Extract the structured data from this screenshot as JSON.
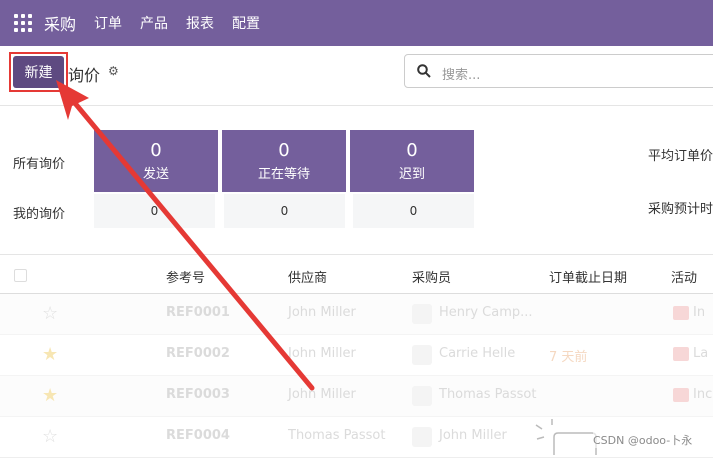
{
  "topbar": {
    "app_name": "采购",
    "menu": [
      "订单",
      "产品",
      "报表",
      "配置"
    ]
  },
  "control": {
    "new_button": "新建",
    "title": "询价",
    "search_placeholder": "搜索..."
  },
  "dashboard": {
    "row_labels": [
      "所有询价",
      "我的询价"
    ],
    "tiles": [
      {
        "count": "0",
        "label": "发送"
      },
      {
        "count": "0",
        "label": "正在等待"
      },
      {
        "count": "0",
        "label": "迟到"
      }
    ],
    "my_counts": [
      "0",
      "0",
      "0"
    ],
    "right_labels": [
      "平均订单价",
      "采购预计时"
    ]
  },
  "table": {
    "headers": [
      "参考号",
      "供应商",
      "采购员",
      "订单截止日期",
      "活动"
    ],
    "rows": [
      {
        "ref": "REF0001",
        "vendor": "John Miller",
        "buyer": "Henry Camp...",
        "deadline": "",
        "activity": "In"
      },
      {
        "ref": "REF0002",
        "vendor": "John Miller",
        "buyer": "Carrie Helle",
        "deadline": "7 天前",
        "activity": "La"
      },
      {
        "ref": "REF0003",
        "vendor": "John Miller",
        "buyer": "Thomas Passot",
        "deadline": "",
        "activity": "Inc"
      },
      {
        "ref": "REF0004",
        "vendor": "Thomas Passot",
        "buyer": "John Miller",
        "deadline": "",
        "activity": ""
      }
    ]
  },
  "watermark": "CSDN @odoo-卜永"
}
